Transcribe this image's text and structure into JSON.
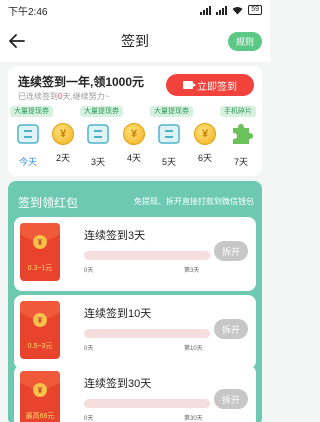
{
  "status_bar": {
    "time": "下午2:46",
    "battery": "59"
  },
  "nav": {
    "title": "签到",
    "rules_label": "规则"
  },
  "checkin": {
    "title": "连续签到一年,领1000元",
    "subtitle_prefix": "已连续签到",
    "subtitle_count": "0",
    "subtitle_suffix": "天,继续努力~",
    "button_label": "立即签到",
    "tags": [
      "大量提现券",
      "大量提现券",
      "大量提现券",
      "手机碎片"
    ],
    "days": [
      {
        "label": "今天",
        "icon": "ticket-icon"
      },
      {
        "label": "2天",
        "icon": "coin-icon"
      },
      {
        "label": "3天",
        "icon": "ticket-icon"
      },
      {
        "label": "4天",
        "icon": "coin-icon"
      },
      {
        "label": "5天",
        "icon": "ticket-icon"
      },
      {
        "label": "6天",
        "icon": "coin-icon"
      },
      {
        "label": "7天",
        "icon": "puzzle-icon"
      }
    ],
    "coin_symbol": "¥"
  },
  "hongbao": {
    "title": "签到领红包",
    "subtitle": "免提现、拆开直接打款到微信钱包",
    "tasks": [
      {
        "name": "连续签到3天",
        "amount": "0.3~1元",
        "progress": 0,
        "start": "0天",
        "end": "第3天",
        "button": "拆开",
        "seal": "¥"
      },
      {
        "name": "连续签到10天",
        "amount": "0.5~3元",
        "progress": 0,
        "start": "0天",
        "end": "第10天",
        "button": "拆开",
        "seal": "¥"
      },
      {
        "name": "连续签到30天",
        "amount": "最高66元",
        "progress": 0,
        "start": "0天",
        "end": "第30天",
        "button": "拆开",
        "seal": "¥"
      }
    ]
  },
  "colors": {
    "brand_green": "#5cc886",
    "accent_red": "#f2423c",
    "panel_teal": "#6ec9b3"
  }
}
